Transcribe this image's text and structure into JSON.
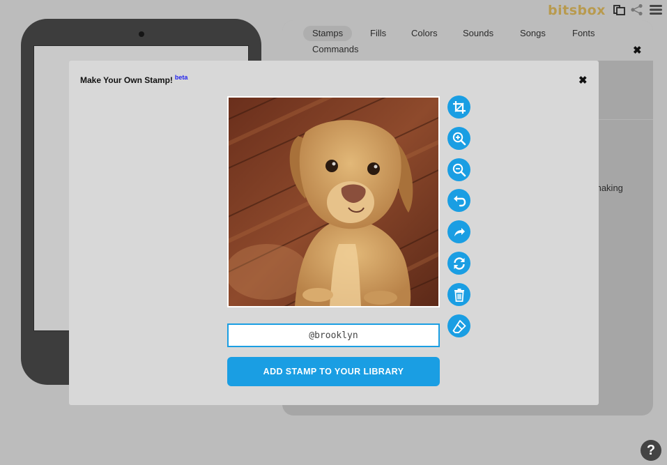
{
  "header": {
    "logo_text": "bitsbox",
    "icons": [
      "stamp-library-icon",
      "share-icon",
      "menu-icon"
    ]
  },
  "drawer": {
    "tabs": [
      {
        "label": "Stamps",
        "active": true
      },
      {
        "label": "Fills",
        "active": false
      },
      {
        "label": "Colors",
        "active": false
      },
      {
        "label": "Sounds",
        "active": false
      },
      {
        "label": "Songs",
        "active": false
      },
      {
        "label": "Fonts",
        "active": false
      },
      {
        "label": "Commands",
        "active": false
      }
    ],
    "close_label": "✖",
    "peek_text": "making"
  },
  "modal": {
    "title": "Make Your Own Stamp!",
    "badge": "beta",
    "close_label": "✖",
    "tools": [
      "crop-icon",
      "zoom-in-icon",
      "zoom-out-icon",
      "rotate-left-icon",
      "rotate-right-icon",
      "reset-icon",
      "delete-icon",
      "erase-icon"
    ],
    "stamp_name": "@brooklyn",
    "add_button_label": "ADD STAMP TO YOUR LIBRARY"
  },
  "help_label": "?",
  "colors": {
    "accent": "#1a9ee3",
    "logo": "#b89a4e"
  }
}
